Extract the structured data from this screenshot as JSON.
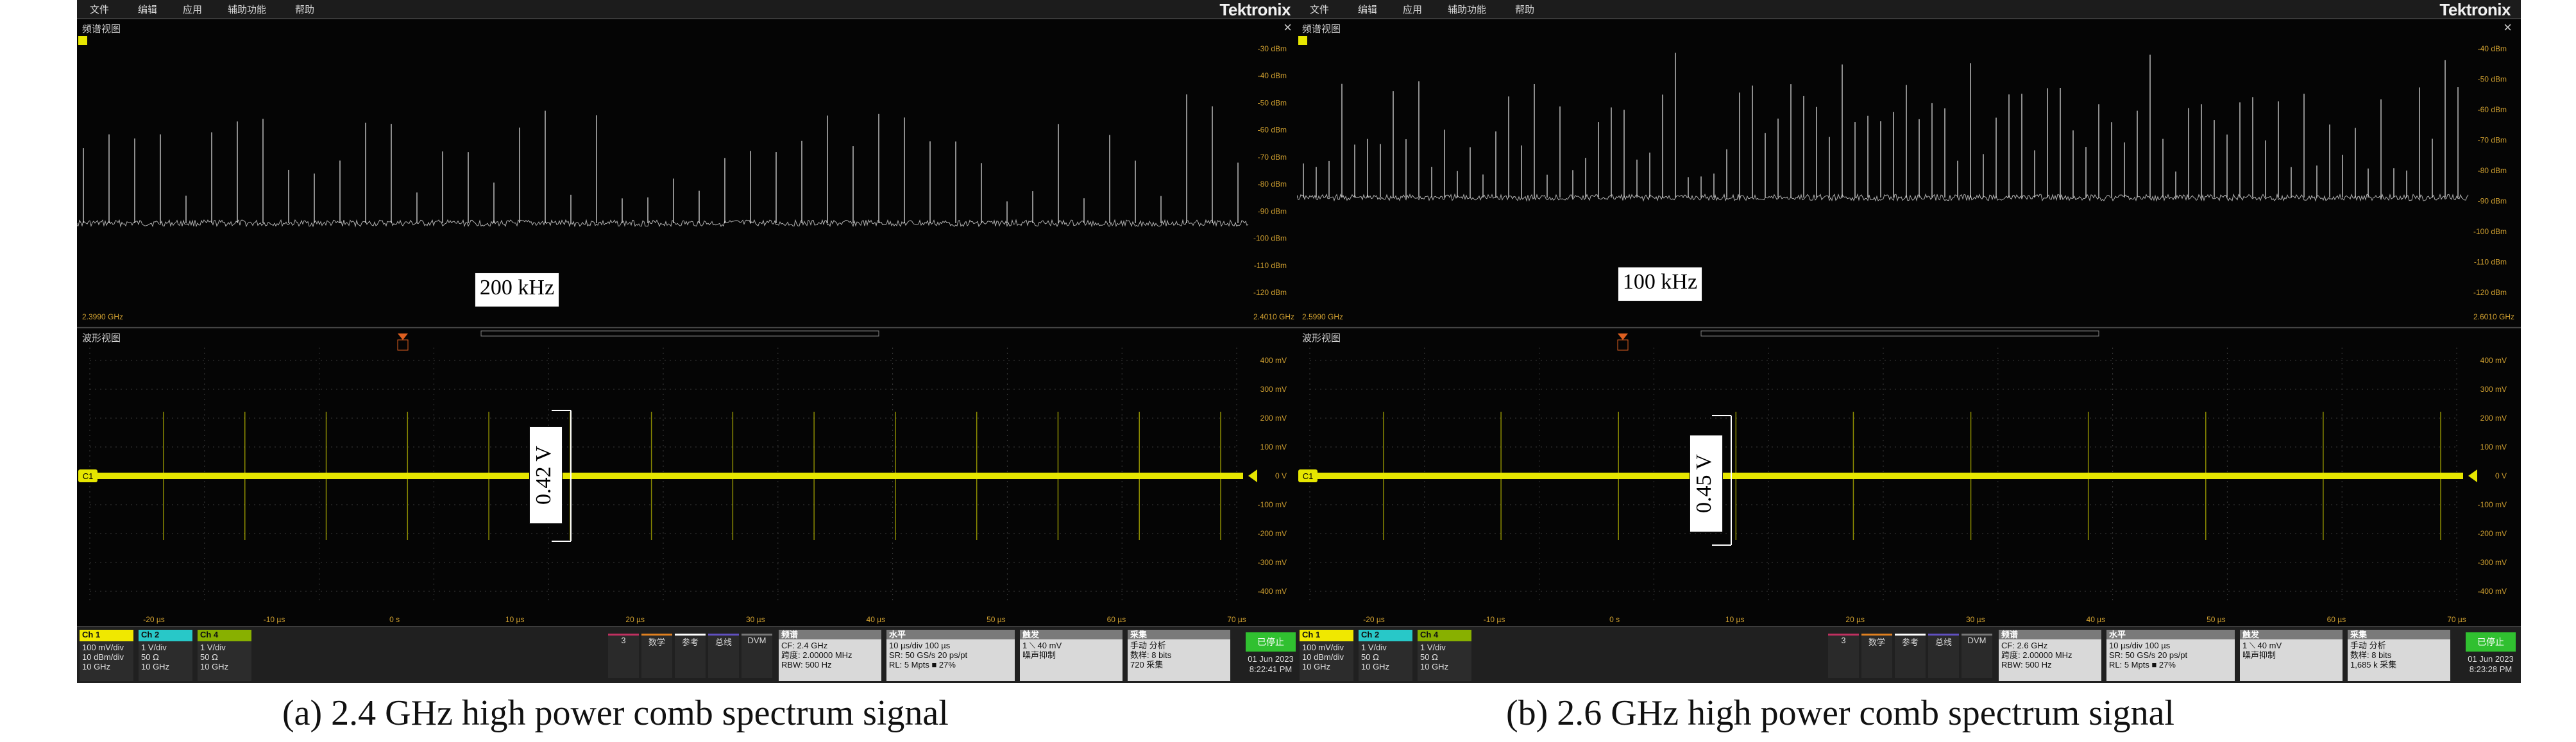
{
  "panels": [
    {
      "menu": [
        "文件",
        "编辑",
        "应用",
        "辅助功能",
        "帮助"
      ],
      "brand": "Tektronix",
      "spectrum": {
        "title": "频谱视图",
        "start_freq": "2.3990 GHz",
        "end_freq": "2.4010 GHz",
        "ref_levels": [
          "-30 dBm",
          "-40 dBm",
          "-50 dBm",
          "-60 dBm",
          "-70 dBm",
          "-80 dBm",
          "-90 dBm",
          "-100 dBm",
          "-110 dBm",
          "-120 dBm"
        ],
        "marker_callout": "200 kHz",
        "comb_spacing_px": 40,
        "floor": 0.72
      },
      "waveform": {
        "title": "波形视图",
        "volt_labels": [
          "400 mV",
          "300 mV",
          "200 mV",
          "100 mV",
          "0 V",
          "-100 mV",
          "-200 mV",
          "-300 mV",
          "-400 mV"
        ],
        "time_labels": [
          "-20 µs",
          "-10 µs",
          "0 s",
          "10 µs",
          "20 µs",
          "30 µs",
          "40 µs",
          "50 µs",
          "60 µs",
          "70 µs"
        ],
        "channel_marker": "C1",
        "amplitude_callout": "0.42 V",
        "pulse_count": 14
      },
      "status": {
        "ch1": {
          "title": "Ch 1",
          "lines": [
            "100 mV/div",
            "10 dBm/div",
            "10 GHz"
          ]
        },
        "ch2": {
          "title": "Ch 2",
          "lines": [
            "1 V/div",
            "50 Ω",
            "10 GHz"
          ]
        },
        "ch4": {
          "title": "Ch 4",
          "lines": [
            "1 V/div",
            "50 Ω",
            "10 GHz"
          ]
        },
        "mini_buttons": [
          "3",
          "数学",
          "参考",
          "总线",
          "DVM"
        ],
        "spectrum_box": {
          "title": "频谱",
          "lines": [
            "CF: 2.4 GHz",
            "跨度: 2.00000 MHz",
            "RBW: 500 Hz"
          ]
        },
        "horizontal_box": {
          "title": "水平",
          "lines": [
            "10 µs/div   100 µs",
            "SR: 50 GS/s   20 ps/pt",
            "RL: 5 Mpts   ■ 27%"
          ]
        },
        "trigger_box": {
          "title": "触发",
          "lines": [
            "1   ⟍  40 mV",
            "噪声抑制"
          ]
        },
        "acq_box": {
          "title": "采集",
          "lines": [
            "手动     分析",
            "数样: 8 bits",
            "720 采集"
          ]
        },
        "run_label": "已停止",
        "date": "01 Jun 2023",
        "time": "8:22:41 PM"
      },
      "caption": "(a) 2.4 GHz high power comb spectrum signal"
    },
    {
      "menu": [
        "文件",
        "编辑",
        "应用",
        "辅助功能",
        "帮助"
      ],
      "brand": "Tektronix",
      "spectrum": {
        "title": "频谱视图",
        "start_freq": "2.5990 GHz",
        "end_freq": "2.6010 GHz",
        "ref_levels": [
          "-40 dBm",
          "-50 dBm",
          "-60 dBm",
          "-70 dBm",
          "-80 dBm",
          "-90 dBm",
          "-100 dBm",
          "-110 dBm",
          "-120 dBm"
        ],
        "marker_callout": "100 kHz",
        "comb_spacing_px": 20,
        "floor": 0.62
      },
      "waveform": {
        "title": "波形视图",
        "volt_labels": [
          "400 mV",
          "300 mV",
          "200 mV",
          "100 mV",
          "0 V",
          "-100 mV",
          "-200 mV",
          "-300 mV",
          "-400 mV"
        ],
        "time_labels": [
          "-20 µs",
          "-10 µs",
          "0 s",
          "10 µs",
          "20 µs",
          "30 µs",
          "40 µs",
          "50 µs",
          "60 µs",
          "70 µs"
        ],
        "channel_marker": "C1",
        "amplitude_callout": "0.45 V",
        "pulse_count": 10
      },
      "status": {
        "ch1": {
          "title": "Ch 1",
          "lines": [
            "100 mV/div",
            "10 dBm/div",
            "10 GHz"
          ]
        },
        "ch2": {
          "title": "Ch 2",
          "lines": [
            "1 V/div",
            "50 Ω",
            "10 GHz"
          ]
        },
        "ch4": {
          "title": "Ch 4",
          "lines": [
            "1 V/div",
            "50 Ω",
            "10 GHz"
          ]
        },
        "mini_buttons": [
          "3",
          "数学",
          "参考",
          "总线",
          "DVM"
        ],
        "spectrum_box": {
          "title": "频谱",
          "lines": [
            "CF: 2.6 GHz",
            "跨度: 2.00000 MHz",
            "RBW: 500 Hz"
          ]
        },
        "horizontal_box": {
          "title": "水平",
          "lines": [
            "10 µs/div   100 µs",
            "SR: 50 GS/s   20 ps/pt",
            "RL: 5 Mpts   ■ 27%"
          ]
        },
        "trigger_box": {
          "title": "触发",
          "lines": [
            "1   ⟍  40 mV",
            "噪声抑制"
          ]
        },
        "acq_box": {
          "title": "采集",
          "lines": [
            "手动     分析",
            "数样: 8 bits",
            "1,685 k 采集"
          ]
        },
        "run_label": "已停止",
        "date": "01 Jun 2023",
        "time": "8:23:28 PM"
      },
      "caption": "(b) 2.6 GHz high power comb spectrum signal"
    }
  ],
  "colors": {
    "trace": "#e6e600",
    "spectrum": "#d8d8d8",
    "grid": "#3a3a3a",
    "ch1": "#f0e800",
    "ch2": "#28c8c8",
    "ch4": "#88b000"
  }
}
